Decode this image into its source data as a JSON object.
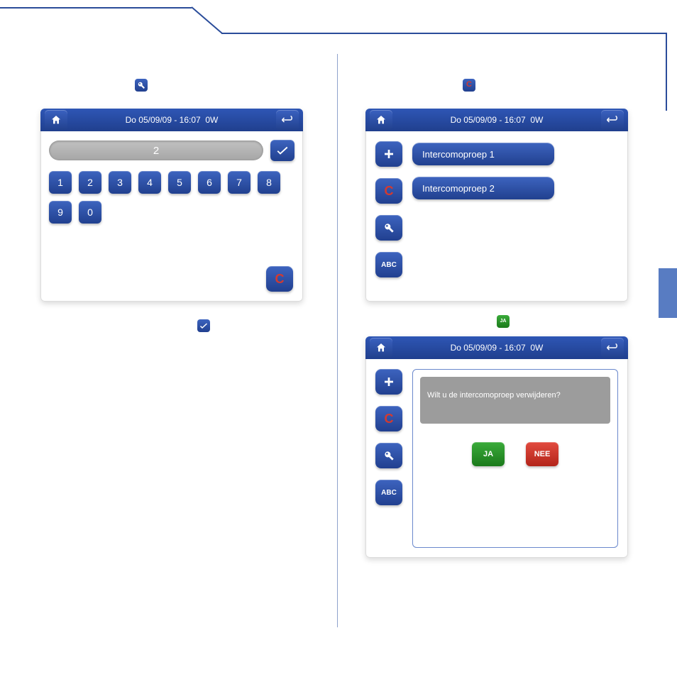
{
  "header": {
    "datetime": "Do 05/09/09 - 16:07",
    "suffix": "0W"
  },
  "keypad": {
    "display_value": "2",
    "keys": [
      "1",
      "2",
      "3",
      "4",
      "5",
      "6",
      "7",
      "8",
      "9",
      "0"
    ],
    "clear_label": "C"
  },
  "intercom_list": {
    "items": [
      {
        "label": "Intercomoproep 1"
      },
      {
        "label": "Intercomoproep 2"
      }
    ],
    "side": {
      "delete_label": "C",
      "abc_label": "ABC"
    }
  },
  "confirm": {
    "message": "Wilt u de intercomoproep verwijderen?",
    "yes": "JA",
    "no": "NEE"
  },
  "icons": {
    "delete_c": "C",
    "ja": "JA"
  }
}
